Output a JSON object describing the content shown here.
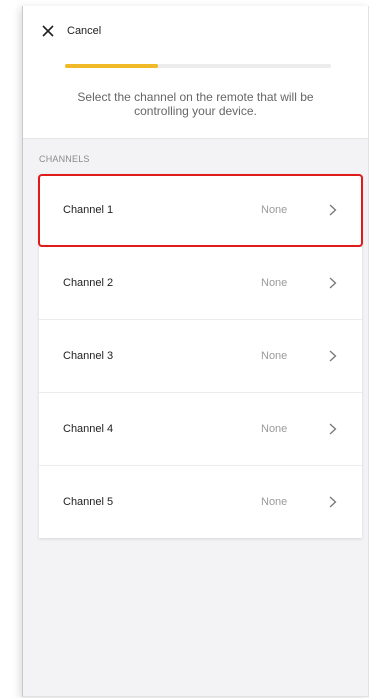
{
  "header": {
    "cancel_label": "Cancel",
    "progress_percent": 35,
    "instruction": "Select the channel on the remote that will be controlling your device."
  },
  "channels": {
    "section_label": "CHANNELS",
    "items": [
      {
        "name": "Channel 1",
        "value": "None"
      },
      {
        "name": "Channel 2",
        "value": "None"
      },
      {
        "name": "Channel 3",
        "value": "None"
      },
      {
        "name": "Channel 4",
        "value": "None"
      },
      {
        "name": "Channel 5",
        "value": "None"
      }
    ]
  },
  "colors": {
    "accent": "#f0b928",
    "highlight": "#e01b1b"
  }
}
